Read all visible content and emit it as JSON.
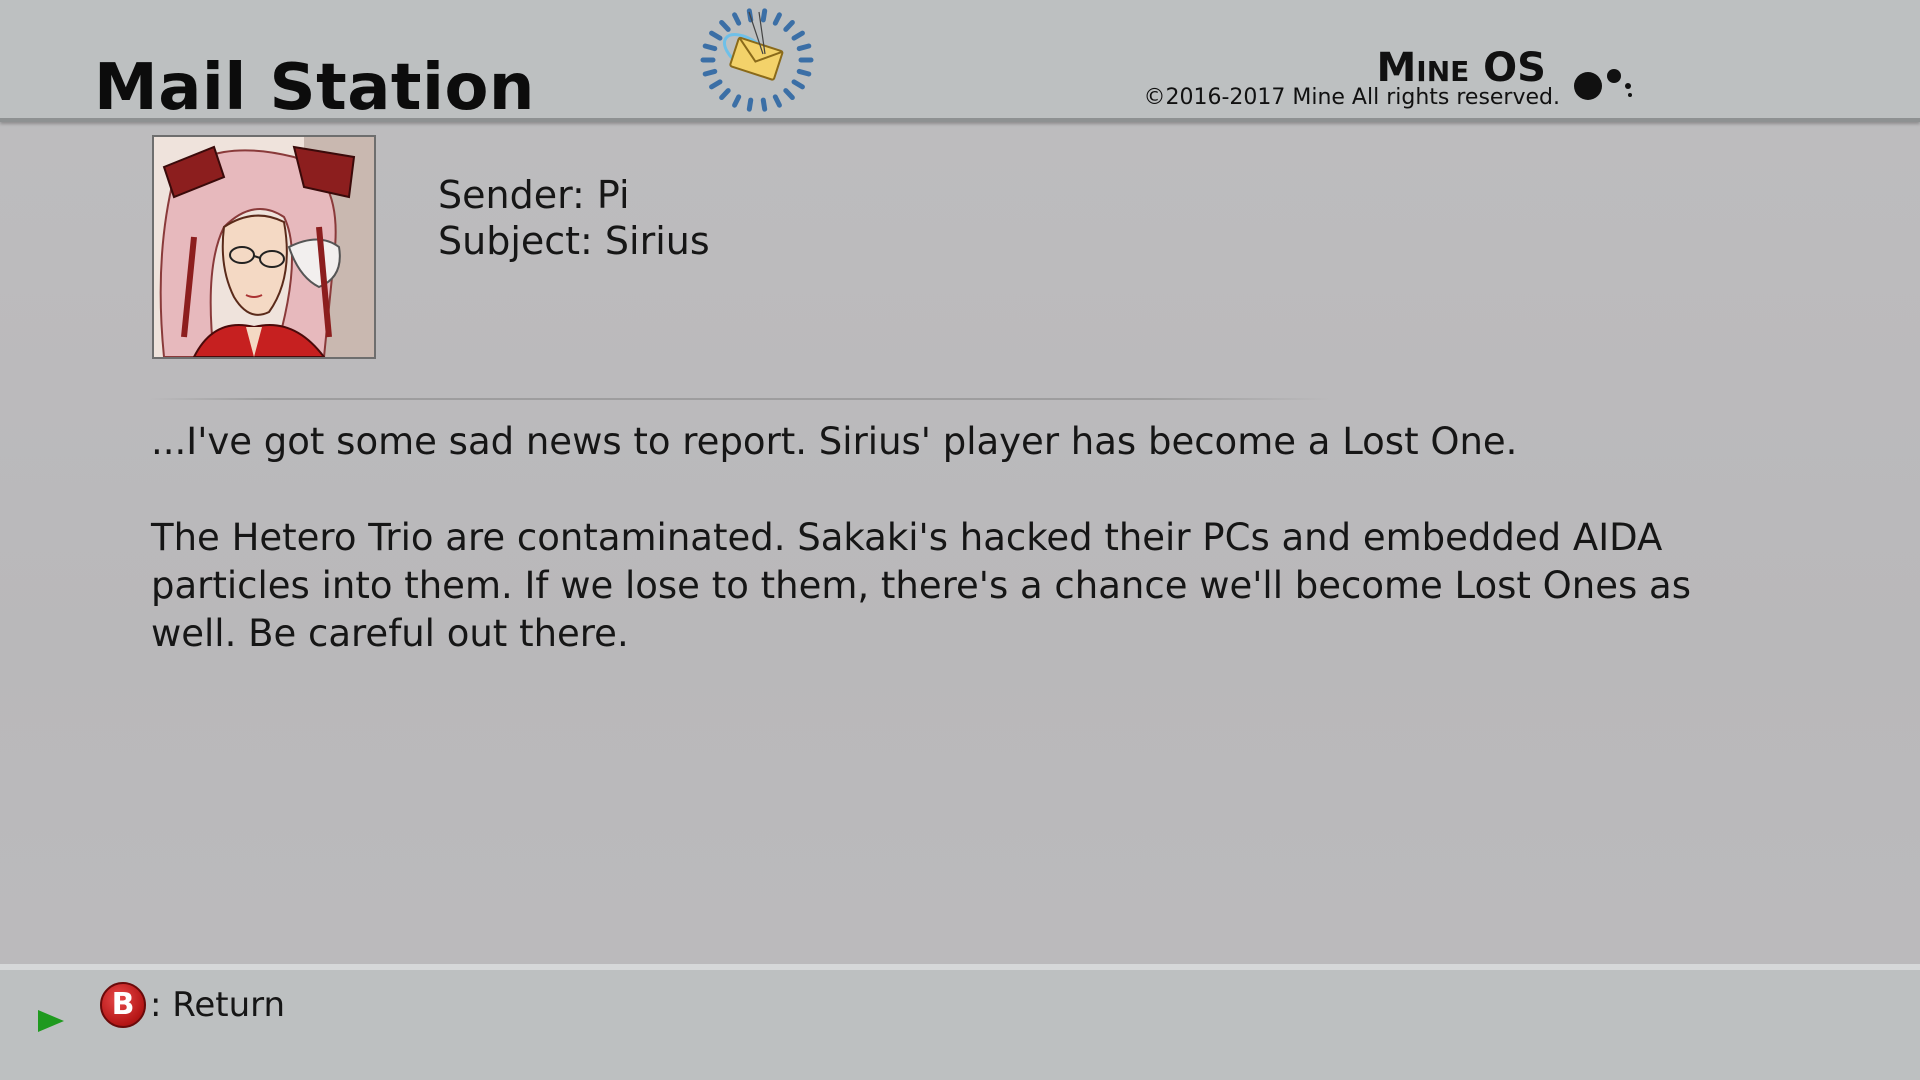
{
  "header": {
    "title": "Mail Station",
    "brand_name": "Mine OS",
    "copyright": "©2016-2017 Mine All rights reserved.",
    "mail_icon": "mail-envelope-icon",
    "brand_icon": "dots-logo-icon"
  },
  "message": {
    "sender_label": "Sender: Pi",
    "subject_label": "Subject: Sirius",
    "avatar": "sender-portrait",
    "paragraphs": [
      "...I've got some sad news to report. Sirius' player has become a Lost One.",
      "The Hetero Trio are contaminated. Sakaki's hacked their PCs and embedded AIDA particles into them. If we lose to them, there's a chance we'll become Lost Ones as well. Be careful out there."
    ]
  },
  "footer": {
    "button_glyph": "B",
    "return_label": ": Return",
    "arrow_icon": "play-arrow-icon"
  },
  "colors": {
    "background": "#bbbabc",
    "header_bar": "#bdc0c1",
    "button_red": "#c41e1e",
    "arrow_green": "#1f9a1f",
    "logo_blue": "#3a6ea8"
  }
}
